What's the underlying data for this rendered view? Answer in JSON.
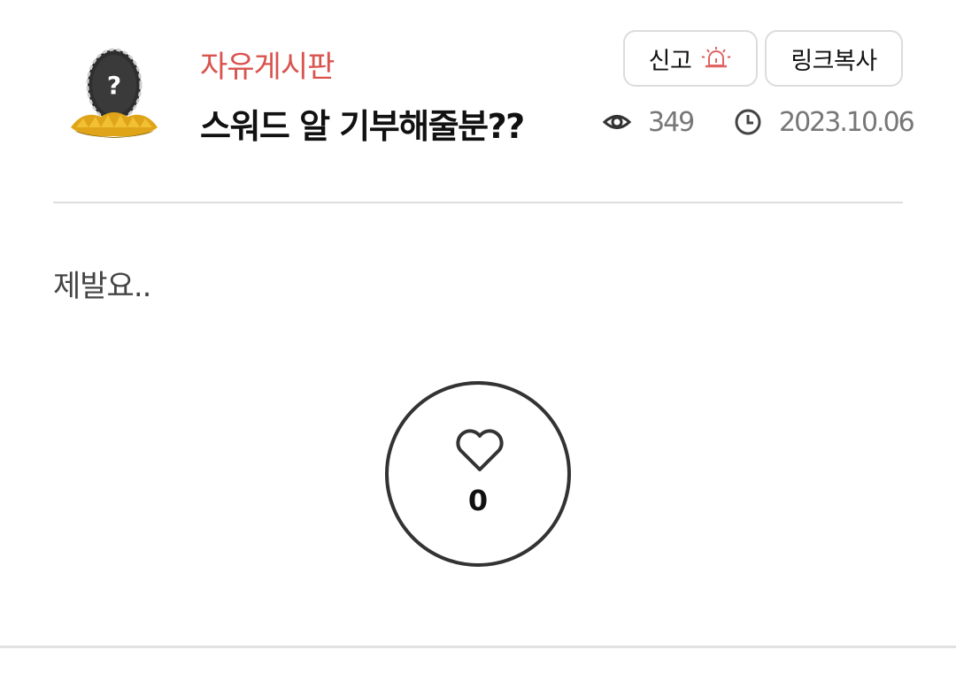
{
  "post": {
    "board": "자유게시판",
    "title": "스워드 알 기부해줄분??",
    "views": "349",
    "date": "2023.10.06",
    "body": "제발요.."
  },
  "actions": {
    "report_label": "신고",
    "copy_link_label": "링크복사"
  },
  "like": {
    "count": "0"
  },
  "icons": {
    "avatar": "mystery-egg-icon",
    "report": "siren-icon",
    "views": "eye-icon",
    "date": "clock-icon",
    "like": "heart-icon"
  },
  "colors": {
    "board_name": "#d9534f",
    "siren": "#e06464",
    "meta_text": "#777777"
  }
}
